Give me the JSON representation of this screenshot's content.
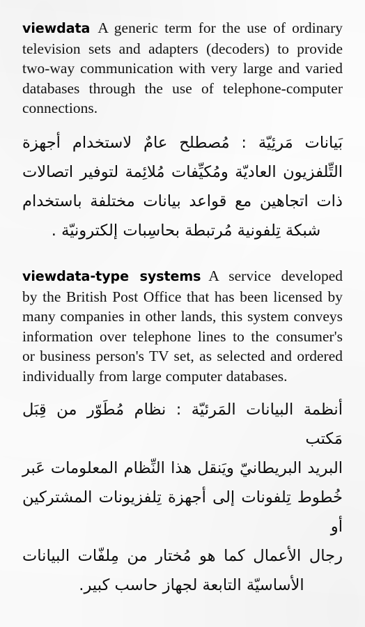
{
  "page": {
    "kind": "bilingual-dictionary-page",
    "language_primary": "English",
    "language_secondary": "Arabic",
    "ink_color": "#0d0d0d",
    "paper_color": "#fdfdfd"
  },
  "entries": [
    {
      "id": "viewdata",
      "headword": "viewdata",
      "definition_en": "A generic term for the use of ordinary television sets and adapters (decoders) to provide two-way communication with very large and varied databases through the use of telephone-computer connections.",
      "definition_en_lines": [
        "A generic term for the use of",
        "ordinary television sets and adapters (de-",
        "coders) to provide two-way communica-",
        "tion with very large and varied databases",
        "through the use of telephone-computer",
        "connections."
      ],
      "definition_ar_lines": [
        "بَيانات مَرئِيّة : مُصطلح عامٌ لاستخدام أجهزة",
        "التِّلفزيون العاديّة ومُكيِّفات مُلائِمة لتوفير اتصالات",
        "ذات اتجاهين مع قواعد بيانات مختلفة باستخدام",
        "شبكة تِلفونية مُرتبطة بحاسِبات إلكترونيّة ."
      ]
    },
    {
      "id": "viewdata-type-systems",
      "headword": "viewdata-type systems",
      "definition_en": "A service developed by the British Post Office that has been licensed by many companies in other lands, this system conveys information over telephone lines to the consumer's or business person's TV set, as selected and ordered individually from large computer databases.",
      "definition_en_lines": [
        "A service de-",
        "veloped by the British Post Office that has",
        "been licensed by many companies in other",
        "lands, this system conveys information",
        "over telephone lines to the consumer's or",
        "business person's TV set, as selected and",
        "ordered individually from large computer",
        "databases."
      ],
      "definition_ar_lines": [
        "أنظمة البيانات المَرئيّة : نظام مُطَوّر من قِبَل مَكتب",
        "البريد البريطانيّ ويَنقل هذا النِّظام المعلومات عَبر",
        "خُطوط تِلفونات إلى أجهزة تِلفزيونات المشتركين أو",
        "رجال الأعمال كما هو مُختار من مِلفّات البيانات",
        "الأساسيّة التابعة لجهاز حاسب كبير."
      ]
    }
  ]
}
